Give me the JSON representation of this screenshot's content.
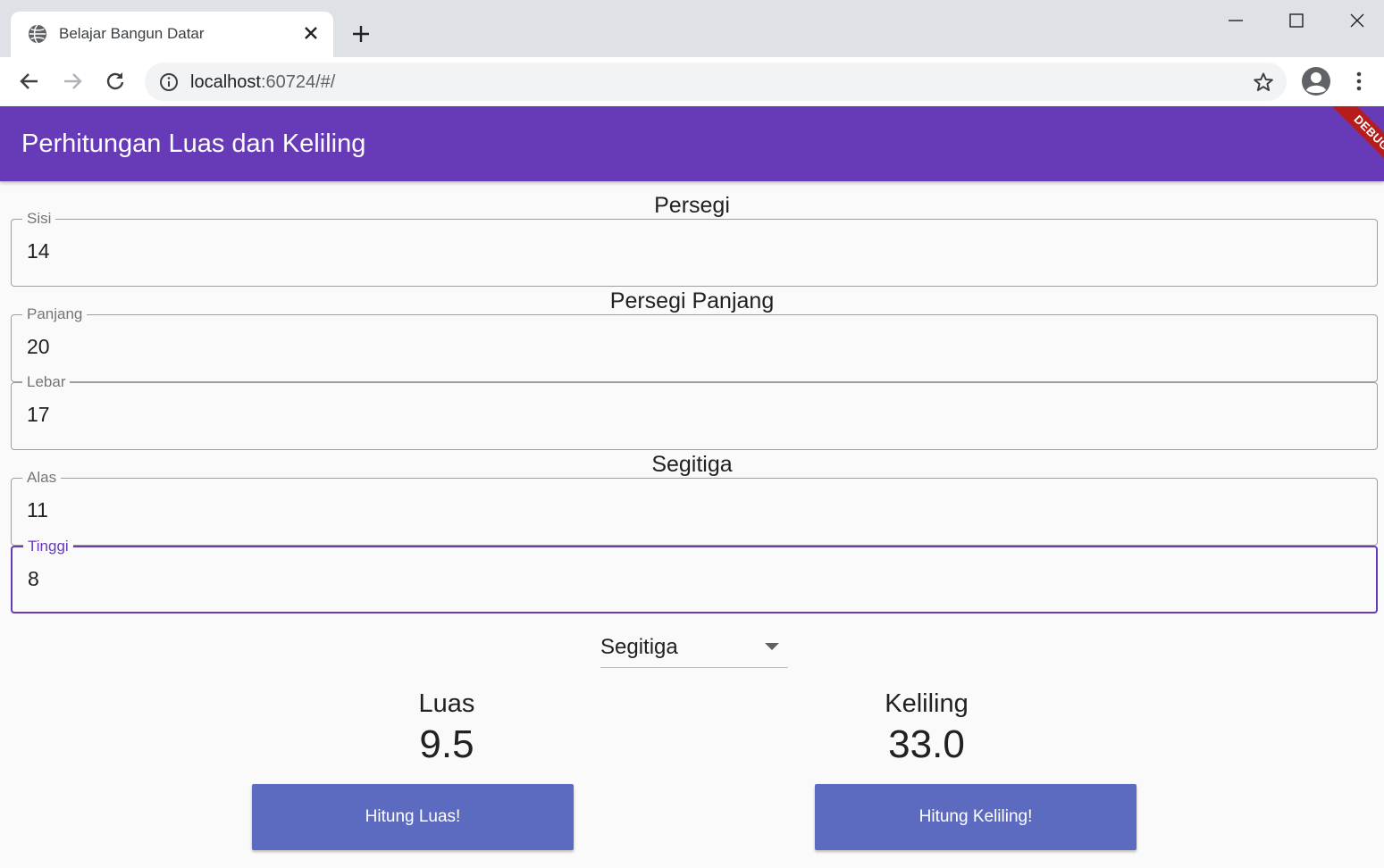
{
  "browser": {
    "tab_title": "Belajar Bangun Datar",
    "url_host": "localhost",
    "url_rest": ":60724/#/"
  },
  "appbar": {
    "title": "Perhitungan Luas dan Keliling",
    "debug_label": "DEBUG",
    "color": "#673ab7"
  },
  "sections": {
    "persegi": "Persegi",
    "persegi_panjang": "Persegi Panjang",
    "segitiga": "Segitiga"
  },
  "fields": {
    "sisi": {
      "label": "Sisi",
      "value": "14"
    },
    "panjang": {
      "label": "Panjang",
      "value": "20"
    },
    "lebar": {
      "label": "Lebar",
      "value": "17"
    },
    "alas": {
      "label": "Alas",
      "value": "11"
    },
    "tinggi": {
      "label": "Tinggi",
      "value": "8"
    }
  },
  "dropdown": {
    "selected": "Segitiga"
  },
  "results": {
    "luas_label": "Luas",
    "luas_value": "9.5",
    "keliling_label": "Keliling",
    "keliling_value": "33.0"
  },
  "buttons": {
    "hitung_luas": "Hitung Luas!",
    "hitung_keliling": "Hitung Keliling!",
    "color": "#5c6bc0"
  }
}
